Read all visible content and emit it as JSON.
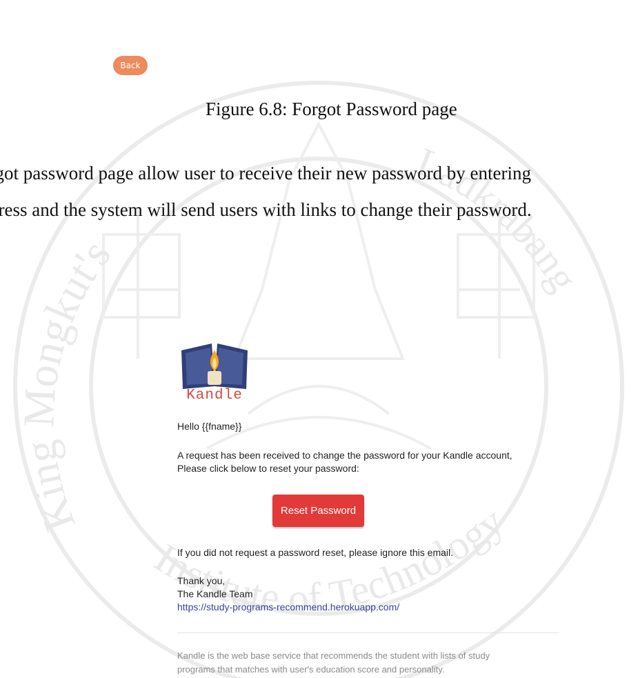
{
  "back_button": {
    "label": "Back"
  },
  "caption": "Figure 6.8: Forgot Password page",
  "paragraph": {
    "line1": "rgot password page allow user to receive their new password by entering",
    "line2": "dress and the system will send users with links to change their password."
  },
  "email": {
    "logo_text": "Kandle",
    "greeting": "Hello {{fname}}",
    "request_line1": "A request has been received to change the password for your Kandle account,",
    "request_line2": "Please click below to reset your password:",
    "reset_button": "Reset Password",
    "ignore_text": "If you did not request a password reset, please ignore this email.",
    "thanks": "Thank you,",
    "team": "The Kandle Team",
    "link": "https://study-programs-recommend.herokuapp.com/",
    "footer_line1": "Kandle is the web base service that recommends the student with lists of study",
    "footer_line2": "programs that matches with user's education score and personality."
  },
  "watermark_text": {
    "left": "King Mongkut's",
    "bottom": "Institute of Technology",
    "right": "Ladkrabang"
  },
  "colors": {
    "back_button": "#ee8a5e",
    "reset_button": "#e23a38",
    "logo_text": "#d9473d",
    "link": "#3c3f9c",
    "watermark": "#e6e6e6"
  }
}
